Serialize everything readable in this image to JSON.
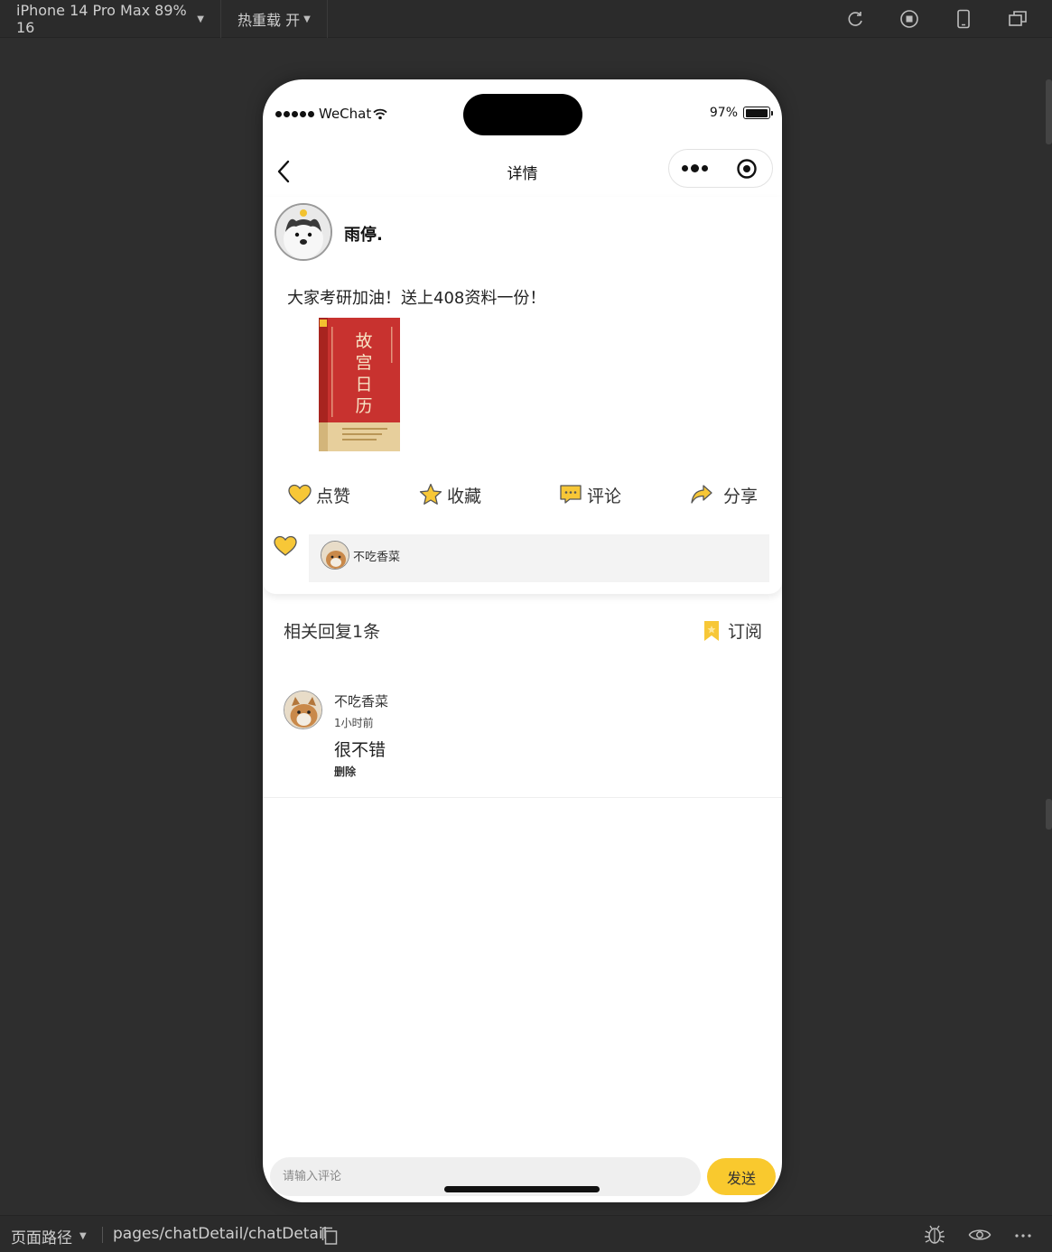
{
  "toolbar": {
    "device": "iPhone 14 Pro Max 89% 16",
    "hot_reload": "热重载 开",
    "icons": [
      "refresh-icon",
      "stop-icon",
      "device-icon",
      "window-icon"
    ]
  },
  "status_bar": {
    "carrier": "WeChat",
    "battery": "97%",
    "battery_level": 0.97
  },
  "nav": {
    "title": "详情"
  },
  "post": {
    "author": "雨停.",
    "text": "大家考研加油！送上408资料一份！",
    "book": {
      "title_chars": [
        "故",
        "宫",
        "日",
        "历"
      ],
      "color": "#c8322f"
    },
    "actions": [
      {
        "label": "点赞",
        "icon": "heart-icon"
      },
      {
        "label": "收藏",
        "icon": "star-icon"
      },
      {
        "label": "评论",
        "icon": "comment-icon"
      },
      {
        "label": "分享",
        "icon": "share-icon"
      }
    ],
    "likers": [
      "不吃香菜"
    ]
  },
  "replies": {
    "header": "相关回复1条",
    "subscribe": "订阅",
    "items": [
      {
        "name": "不吃香菜",
        "time": "1小时前",
        "text": "很不错",
        "delete": "删除"
      }
    ]
  },
  "composer": {
    "placeholder": "请输入评论",
    "send": "发送"
  },
  "bottom_bar": {
    "label": "页面路径",
    "path": "pages/chatDetail/chatDetail"
  },
  "colors": {
    "accent": "#f9c92e",
    "icon_yellow": "#f2c230"
  }
}
